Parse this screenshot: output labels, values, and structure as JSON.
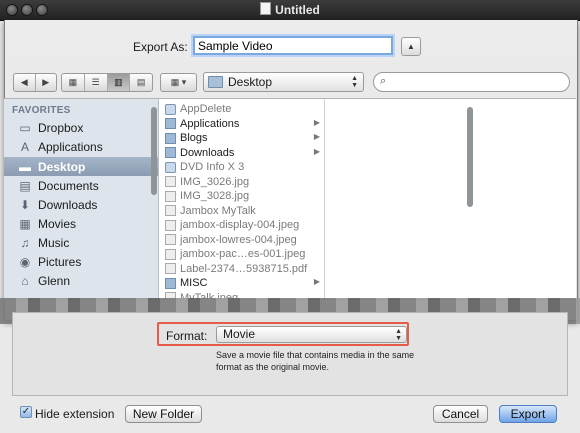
{
  "window": {
    "title": "Untitled"
  },
  "export": {
    "label": "Export As:",
    "value": "Sample Video"
  },
  "toolbar": {
    "location": "Desktop",
    "search_placeholder": ""
  },
  "sidebar": {
    "header": "FAVORITES",
    "items": [
      {
        "label": "Dropbox",
        "icon": "folder-icon"
      },
      {
        "label": "Applications",
        "icon": "applications-icon"
      },
      {
        "label": "Desktop",
        "icon": "desktop-icon",
        "selected": true
      },
      {
        "label": "Documents",
        "icon": "documents-icon"
      },
      {
        "label": "Downloads",
        "icon": "downloads-icon"
      },
      {
        "label": "Movies",
        "icon": "movies-icon"
      },
      {
        "label": "Music",
        "icon": "music-icon"
      },
      {
        "label": "Pictures",
        "icon": "pictures-icon"
      },
      {
        "label": "Glenn",
        "icon": "home-icon"
      }
    ]
  },
  "files": [
    {
      "name": "AppDelete",
      "kind": "app",
      "dim": true
    },
    {
      "name": "Applications",
      "kind": "folder",
      "chevron": true
    },
    {
      "name": "Blogs",
      "kind": "folder",
      "chevron": true
    },
    {
      "name": "Downloads",
      "kind": "folder",
      "chevron": true
    },
    {
      "name": "DVD Info X 3",
      "kind": "app",
      "dim": true
    },
    {
      "name": "IMG_3026.jpg",
      "kind": "file",
      "dim": true
    },
    {
      "name": "IMG_3028.jpg",
      "kind": "file",
      "dim": true
    },
    {
      "name": "Jambox MyTalk",
      "kind": "file",
      "dim": true
    },
    {
      "name": "jambox-display-004.jpeg",
      "kind": "file",
      "dim": true
    },
    {
      "name": "jambox-lowres-004.jpeg",
      "kind": "file",
      "dim": true
    },
    {
      "name": "jambox-pac…es-001.jpeg",
      "kind": "file",
      "dim": true
    },
    {
      "name": "Label-2374…5938715.pdf",
      "kind": "file",
      "dim": true
    },
    {
      "name": "MISC",
      "kind": "folder",
      "chevron": true
    },
    {
      "name": "MyTalk.jpeg",
      "kind": "file",
      "dim": true
    }
  ],
  "format": {
    "label": "Format:",
    "value": "Movie",
    "description": "Save a movie file that contains media in the same format as the original movie."
  },
  "footer": {
    "hide_extension": "Hide extension",
    "hide_extension_checked": true,
    "new_folder": "New Folder",
    "cancel": "Cancel",
    "export": "Export"
  }
}
